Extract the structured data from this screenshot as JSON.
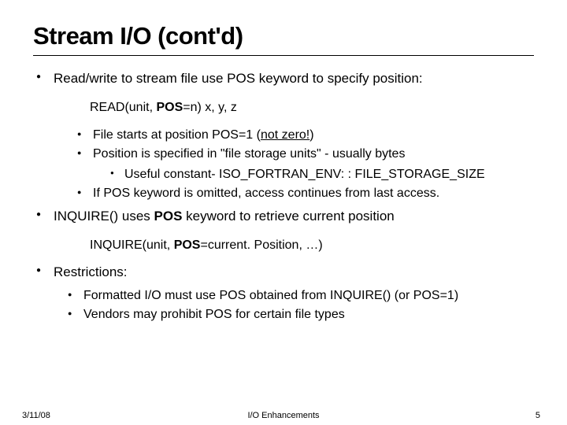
{
  "title": "Stream I/O (cont'd)",
  "bullets": {
    "a": "Read/write to stream file use POS keyword to specify position:",
    "code1_pre": "READ(unit, ",
    "code1_bold": "POS",
    "code1_post": "=n) x, y, z",
    "b1_pre": "File starts at position POS=1 (",
    "b1_ul": "not zero!",
    "b1_post": ")",
    "b2": "Position is specified in \"file storage units\" - usually bytes",
    "b2a": "Useful constant- ISO_FORTRAN_ENV: : FILE_STORAGE_SIZE",
    "b3": "If POS keyword is omitted, access continues from last access.",
    "c_pre": "INQUIRE() uses ",
    "c_bold": "POS",
    "c_post": " keyword to retrieve current position",
    "code2_pre": "INQUIRE(unit, ",
    "code2_bold": "POS",
    "code2_post": "=current. Position, …)",
    "d": "Restrictions:",
    "d1": "Formatted I/O must use POS obtained from INQUIRE() (or POS=1)",
    "d2": "Vendors may prohibit POS for certain file types"
  },
  "footer": {
    "date": "3/11/08",
    "center": "I/O Enhancements",
    "page": "5"
  }
}
